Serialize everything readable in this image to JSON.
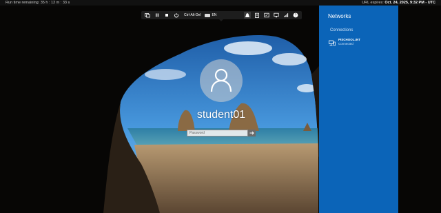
{
  "session_bar": {
    "runtime_label": "Run time remaining:",
    "runtime_value": "35 h : 12 m : 33 s",
    "expires_label": "URL expires:",
    "expires_value": "Oct. 24, 2025, 9:32 PM - UTC"
  },
  "toolbar": {
    "items": [
      {
        "name": "switch-window",
        "icon": "windows-icon"
      },
      {
        "name": "pause",
        "icon": "pause-icon"
      },
      {
        "name": "stop",
        "icon": "stop-icon"
      },
      {
        "name": "power",
        "icon": "power-icon"
      }
    ],
    "ctrl_alt_del_label": "Ctrl-Alt-Del",
    "keyboard_label": "EN",
    "tools": [
      {
        "name": "network",
        "icon": "network-icon",
        "active": true
      },
      {
        "name": "clipboard",
        "icon": "clipboard-icon"
      },
      {
        "name": "fit-screen",
        "icon": "fit-screen-icon"
      },
      {
        "name": "display",
        "icon": "monitor-icon"
      },
      {
        "name": "signal",
        "icon": "signal-icon"
      }
    ],
    "help_icon": "help-icon"
  },
  "login": {
    "username": "student01",
    "password_placeholder": "Password",
    "submit_icon": "arrow-right-icon"
  },
  "networks_panel": {
    "title": "Networks",
    "section": "Connections",
    "items": [
      {
        "name": "PISCHOOL.INT",
        "status": "Connected",
        "icon": "network-computer-icon"
      }
    ]
  },
  "colors": {
    "panel_blue": "#0b64b8",
    "sky": "#3d8fd6",
    "sand": "#9a7c59"
  }
}
